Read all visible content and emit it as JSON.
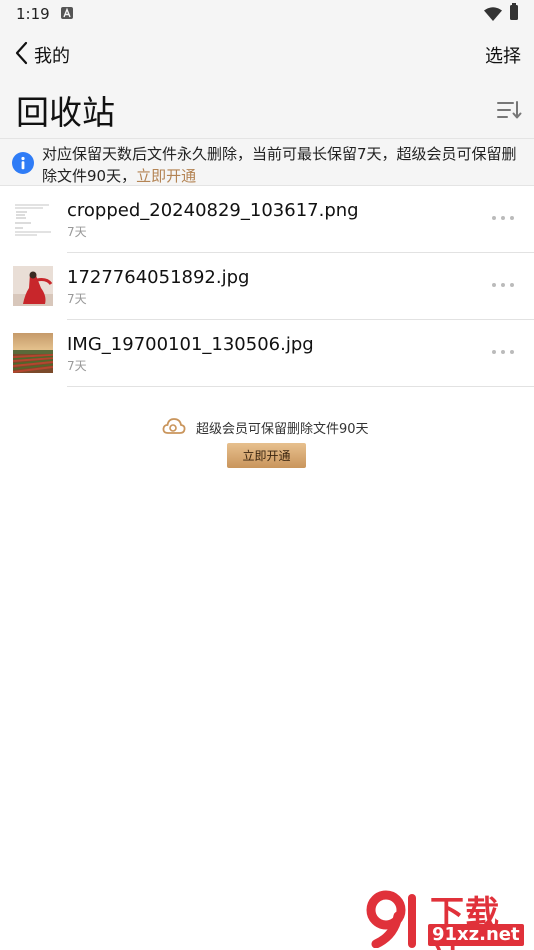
{
  "status_bar": {
    "time": "1:19"
  },
  "header": {
    "back_label": "我的",
    "select_label": "选择",
    "title": "回收站"
  },
  "info_banner": {
    "line1": "对应保留天数后文件永久删除，当前可最长保留7天，超级会员可保留删",
    "line2": "除文件90天，",
    "link": "立即开通"
  },
  "files": [
    {
      "name": "cropped_20240829_103617.png",
      "days": "7天"
    },
    {
      "name": "1727764051892.jpg",
      "days": "7天"
    },
    {
      "name": "IMG_19700101_130506.jpg",
      "days": "7天"
    }
  ],
  "promo": {
    "text": "超级会员可保留删除文件90天",
    "button": "立即开通"
  },
  "watermark": {
    "title": "下载站",
    "url": "91xz.net"
  },
  "colors": {
    "accent_link": "#b48454",
    "info_blue": "#2f7cf6",
    "promo_gold": "#d4a56f",
    "watermark_red": "#e0313a"
  },
  "icons": {
    "back": "chevron-left-icon",
    "sort": "sort-list-icon",
    "info": "info-circle-icon",
    "more": "more-horizontal-icon",
    "cloud": "cloud-icon"
  }
}
